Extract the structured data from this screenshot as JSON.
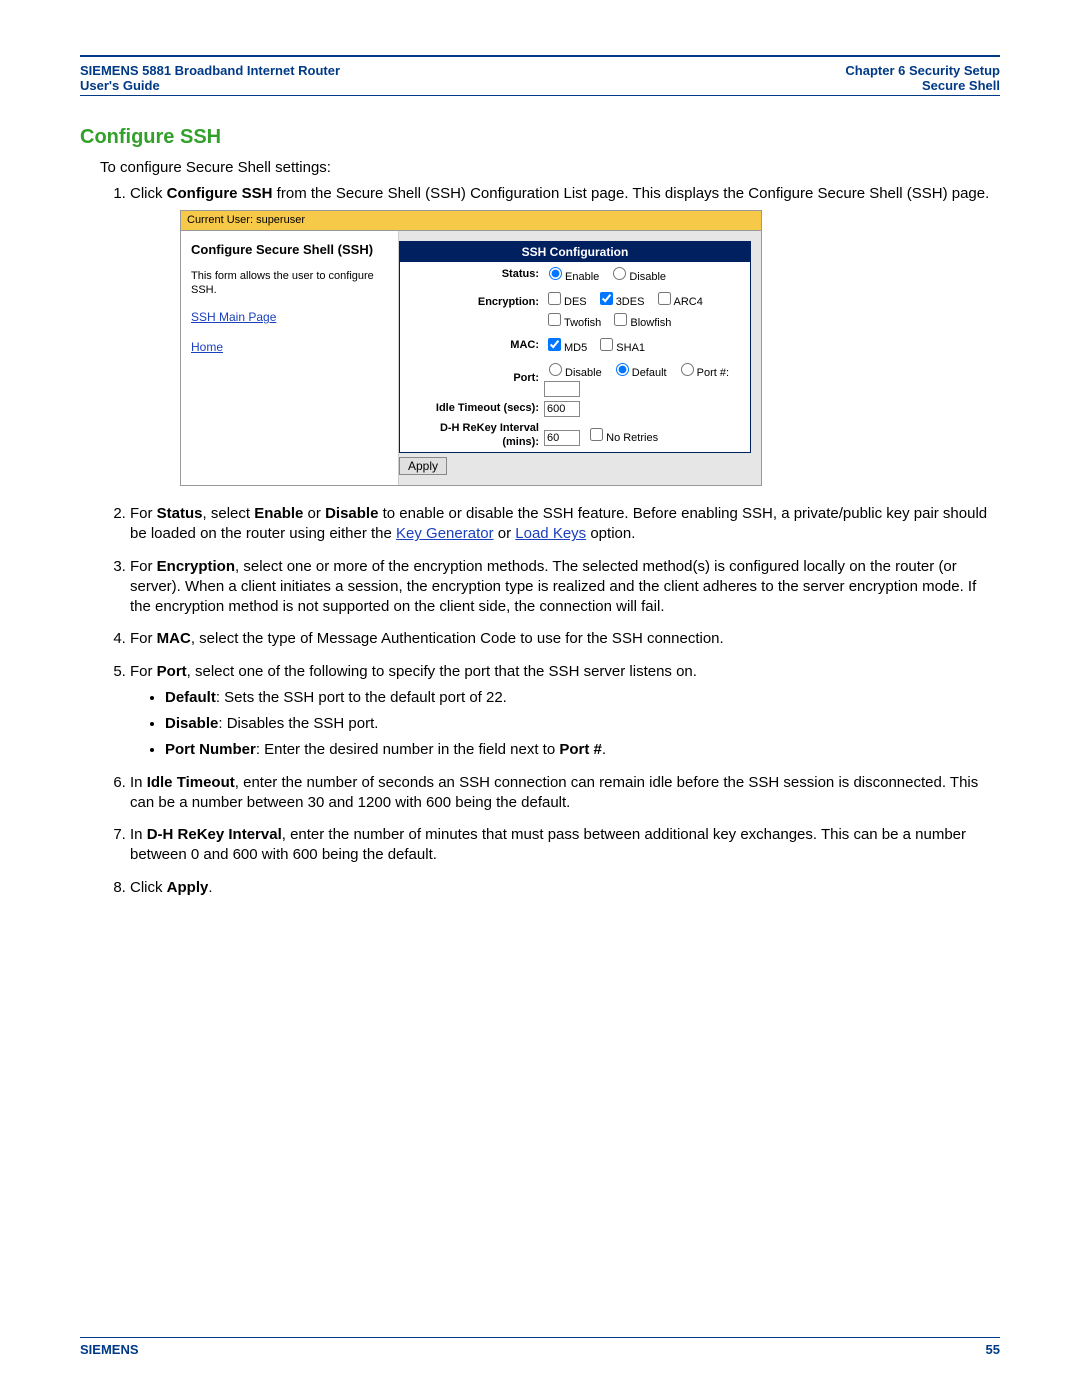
{
  "header": {
    "left_line1": "SIEMENS 5881 Broadband Internet Router",
    "left_line2": "User's Guide",
    "right_line1": "Chapter 6  Security Setup",
    "right_line2": "Secure Shell"
  },
  "section_title": "Configure SSH",
  "intro": "To configure Secure Shell settings:",
  "step1_a": "Click ",
  "step1_b": "Configure SSH",
  "step1_c": " from the Secure Shell (SSH) Configuration List page. This displays the Configure Secure Shell (SSH) page.",
  "shot": {
    "topbar": "Current User: superuser",
    "left_title": "Configure Secure Shell (SSH)",
    "left_desc": "This form allows the user to configure SSH.",
    "link_main": "SSH Main Page",
    "link_home": "Home",
    "table_title": "SSH Configuration",
    "lbl_status": "Status:",
    "opt_enable": "Enable",
    "opt_disable": "Disable",
    "lbl_encryption": "Encryption:",
    "opt_des": "DES",
    "opt_3des": "3DES",
    "opt_arc4": "ARC4",
    "opt_twofish": "Twofish",
    "opt_blowfish": "Blowfish",
    "lbl_mac": "MAC:",
    "opt_md5": "MD5",
    "opt_sha1": "SHA1",
    "lbl_port": "Port:",
    "opt_portdisable": "Disable",
    "opt_default": "Default",
    "opt_portnum": "Port #:",
    "lbl_idle": "Idle Timeout (secs):",
    "val_idle": "600",
    "lbl_dh": "D-H ReKey Interval (mins):",
    "val_dh": "60",
    "opt_noretries": "No Retries",
    "btn_apply": "Apply"
  },
  "step2_a": "For ",
  "step2_b": "Status",
  "step2_c": ", select ",
  "step2_d": "Enable",
  "step2_e": " or ",
  "step2_f": "Disable",
  "step2_g": " to enable or disable the SSH feature. Before enabling SSH, a private/public key pair should be loaded on the router using either the ",
  "step2_link1": "Key Generator",
  "step2_h": " or ",
  "step2_link2": "Load Keys",
  "step2_i": " option.",
  "step3_a": "For ",
  "step3_b": "Encryption",
  "step3_c": ", select one or more of the encryption methods. The selected method(s) is configured locally on the router (or server). When a client initiates a session, the encryption type is realized and the client adheres to the server encryption mode. If the encryption method is not supported on the client side, the connection will fail.",
  "step4_a": "For ",
  "step4_b": "MAC",
  "step4_c": ", select the type of Message Authentication Code to use for the SSH connection.",
  "step5_a": "For ",
  "step5_b": "Port",
  "step5_c": ", select one of the following to specify the port that the SSH server listens on.",
  "bullet1_b": "Default",
  "bullet1_c": ": Sets the SSH port to the default port of 22.",
  "bullet2_b": "Disable",
  "bullet2_c": ": Disables the SSH port.",
  "bullet3_b": "Port Number",
  "bullet3_c": ": Enter the desired number in the field next to ",
  "bullet3_d": "Port #",
  "bullet3_e": ".",
  "step6_a": "In ",
  "step6_b": "Idle Timeout",
  "step6_c": ", enter the number of seconds an SSH connection can remain idle before the SSH session is disconnected. This can be a number between 30 and 1200 with 600 being the default.",
  "step7_a": "In ",
  "step7_b": "D-H ReKey Interval",
  "step7_c": ", enter the number of minutes that must pass between additional key exchanges. This can be a number between 0 and 600 with 600 being the default.",
  "step8_a": "Click ",
  "step8_b": "Apply",
  "step8_c": ".",
  "footer": {
    "brand": "SIEMENS",
    "page": "55"
  }
}
